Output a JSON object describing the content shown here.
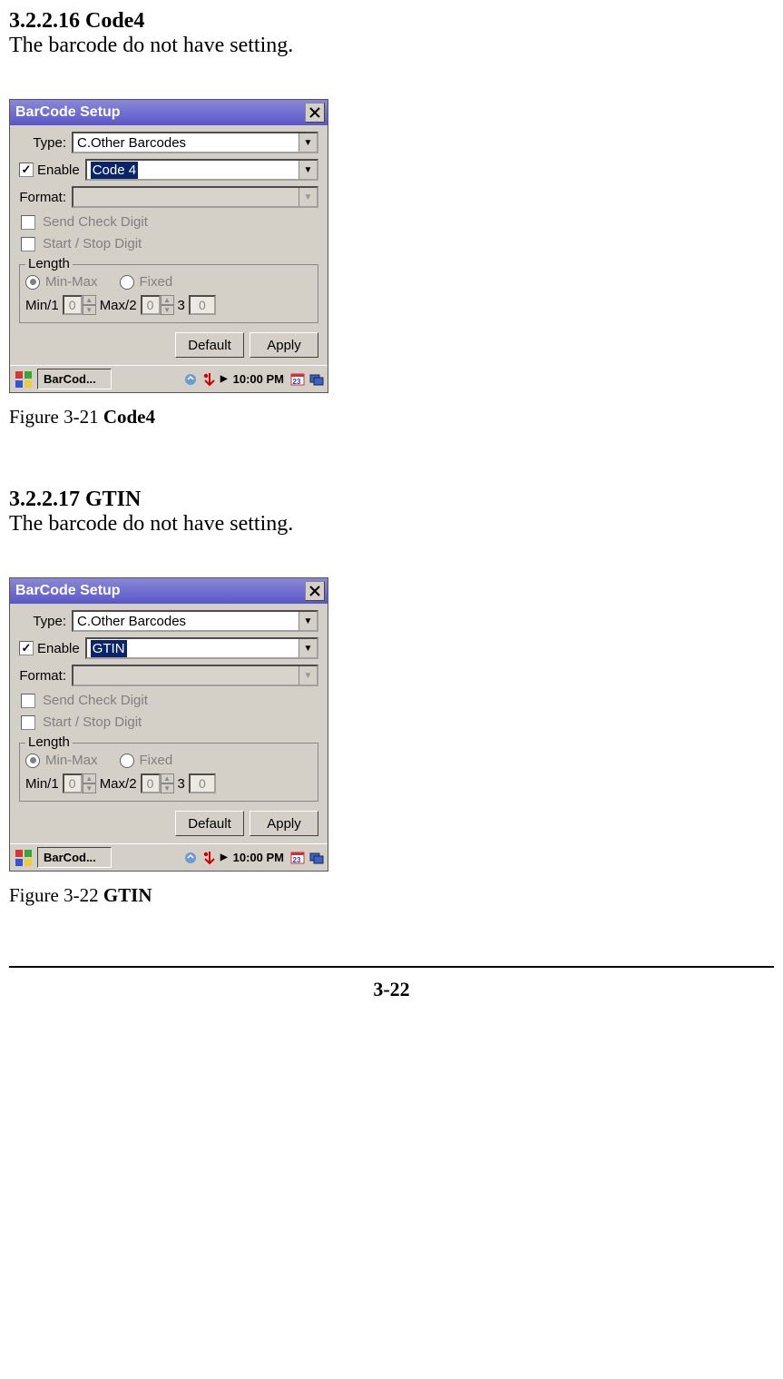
{
  "sections": [
    {
      "id": "code4",
      "number": "3.2.2.16",
      "name": "Code4",
      "desc": "The barcode do not have setting.",
      "caption_prefix": "Figure 3-21 ",
      "caption_name": "Code4",
      "window": {
        "title": "BarCode Setup",
        "type_label": "Type:",
        "type_value": "C.Other Barcodes",
        "enable_label": "Enable",
        "enable_value": "Code 4",
        "format_label": "Format:",
        "send_check": "Send Check Digit",
        "start_stop": "Start / Stop Digit",
        "length_label": "Length",
        "minmax": "Min-Max",
        "fixed": "Fixed",
        "min_label": "Min/1",
        "min_val": "0",
        "max_label": "Max/2",
        "max_val": "0",
        "three_label": "3",
        "three_val": "0",
        "default_btn": "Default",
        "apply_btn": "Apply",
        "taskbar_item": "BarCod...",
        "time": "10:00 PM"
      }
    },
    {
      "id": "gtin",
      "number": "3.2.2.17",
      "name": "GTIN",
      "desc": "The barcode do not have setting.",
      "caption_prefix": "Figure 3-22 ",
      "caption_name": "GTIN",
      "window": {
        "title": "BarCode Setup",
        "type_label": "Type:",
        "type_value": "C.Other Barcodes",
        "enable_label": "Enable",
        "enable_value": "GTIN",
        "format_label": "Format:",
        "send_check": "Send Check Digit",
        "start_stop": "Start / Stop Digit",
        "length_label": "Length",
        "minmax": "Min-Max",
        "fixed": "Fixed",
        "min_label": "Min/1",
        "min_val": "0",
        "max_label": "Max/2",
        "max_val": "0",
        "three_label": "3",
        "three_val": "0",
        "default_btn": "Default",
        "apply_btn": "Apply",
        "taskbar_item": "BarCod...",
        "time": "10:00 PM"
      }
    }
  ],
  "page_number": "3-22"
}
